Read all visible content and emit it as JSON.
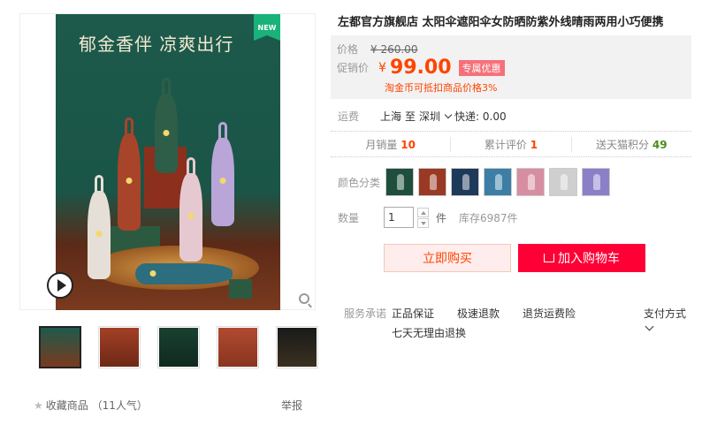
{
  "gallery": {
    "hero_title": "郁金香伴 凉爽出行",
    "badge": "NEW",
    "thumb_count": 5
  },
  "favorites": {
    "label": "收藏商品",
    "popularity": "（11人气）"
  },
  "report_label": "举报",
  "product": {
    "title": "左都官方旗舰店 太阳伞遮阳伞女防晒防紫外线晴雨两用小巧便携"
  },
  "price": {
    "label": "价格",
    "original": "¥ 260.00",
    "promo_label": "促销价",
    "currency": "¥",
    "promo_value": "99.00",
    "promo_tag": "专属优惠",
    "coins_note": "淘金币可抵扣商品价格3%"
  },
  "shipping": {
    "label": "运费",
    "from": "上海",
    "to_word": "至",
    "to": "深圳",
    "express": "快递: 0.00"
  },
  "stats": {
    "monthly_label": "月销量",
    "monthly_value": "10",
    "reviews_label": "累计评价",
    "reviews_value": "1",
    "points_label": "送天猫积分",
    "points_value": "49"
  },
  "colors": {
    "label": "颜色分类",
    "swatches": [
      "#1f4e3d",
      "#9a3a24",
      "#1e3a5a",
      "#3c7ea5",
      "#d88ea2",
      "#cfcfcf",
      "#8b80c8"
    ]
  },
  "quantity": {
    "label": "数量",
    "value": "1",
    "unit": "件",
    "stock": "库存6987件"
  },
  "buttons": {
    "buy_now": "立即购买",
    "add_cart": "加入购物车"
  },
  "service": {
    "label": "服务承诺",
    "items": [
      "正品保证",
      "极速退款",
      "退货运费险",
      "七天无理由退换"
    ],
    "payment": "支付方式"
  },
  "theme": {
    "accent": "#ff0036",
    "price_red": "#ff4400"
  }
}
